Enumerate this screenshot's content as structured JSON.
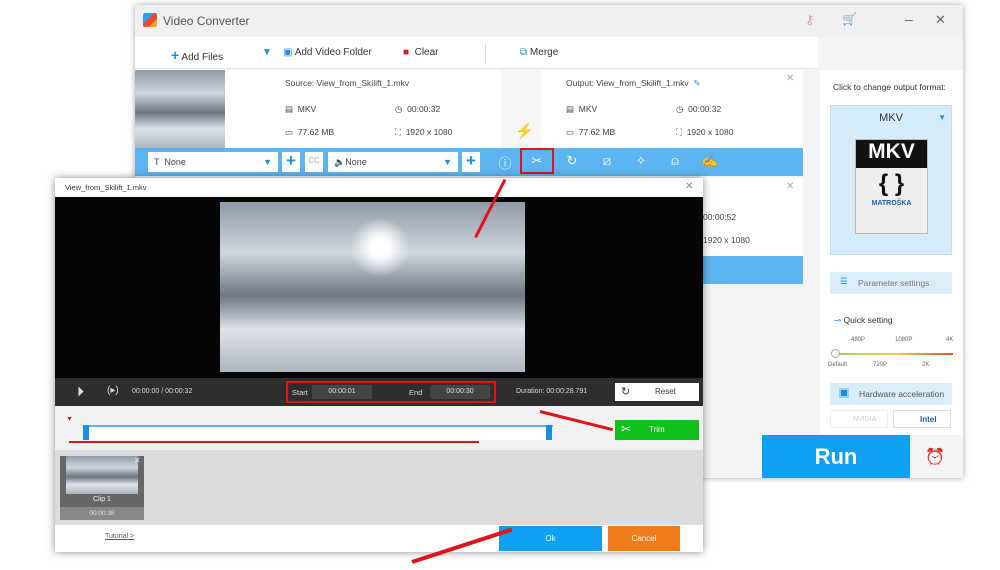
{
  "app": {
    "title": "Video Converter"
  },
  "toolbar": {
    "add_files": "Add Files",
    "add_video_folder": "Add Video Folder",
    "clear": "Clear",
    "merge": "Merge"
  },
  "file1": {
    "source": "Source: View_from_Skilift_1.mkv",
    "output": "Output: View_from_Skilift_1.mkv",
    "src_format": "MKV",
    "src_duration": "00:00:32",
    "src_size": "77.62 MB",
    "src_resolution": "1920 x 1080",
    "out_format": "MKV",
    "out_duration": "00:00:32",
    "out_size": "77.62 MB",
    "out_resolution": "1920 x 1080"
  },
  "file2": {
    "out_duration": "00:00:52",
    "out_resolution": "1920 x 1080"
  },
  "editbar": {
    "subtitle": "None",
    "audio": "None",
    "cc": "CC"
  },
  "right": {
    "hint": "Click to change output format:",
    "format": "MKV",
    "logo_text": "MKV",
    "logo_sub": "MATROŠKA",
    "param": "Parameter settings",
    "quick": "Quick setting",
    "ticks_top": [
      "480P",
      "1080P",
      "4K"
    ],
    "ticks_bottom": [
      "Default",
      "720P",
      "2K"
    ],
    "quality_level": 0,
    "hw": "Hardware acceleration",
    "nvidia": "NVIDIA",
    "intel": "Intel",
    "run": "Run"
  },
  "dialog": {
    "title": "View_from_Skilift_1.mkv",
    "time": "00:00:00",
    "total": "00:00:32",
    "start_label": "Start",
    "start": "00:00:01",
    "end_label": "End",
    "end": "00:00:30",
    "duration_label": "Duration:",
    "duration": "00:00:28.791",
    "reset": "Reset",
    "trim": "Trim",
    "clip_name": "Clip 1",
    "clip_duration": "00:00:38",
    "tutorial": "Tutorial >",
    "ok": "Ok",
    "cancel": "Cancel"
  }
}
